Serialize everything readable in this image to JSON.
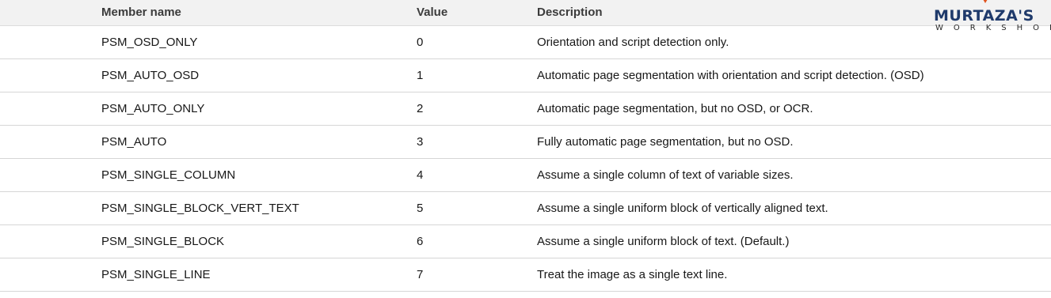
{
  "table": {
    "headers": {
      "member_name": "Member name",
      "value": "Value",
      "description": "Description"
    },
    "rows": [
      {
        "name": "PSM_OSD_ONLY",
        "value": "0",
        "description": "Orientation and script detection only."
      },
      {
        "name": "PSM_AUTO_OSD",
        "value": "1",
        "description": "Automatic page segmentation with orientation and script detection. (OSD)"
      },
      {
        "name": "PSM_AUTO_ONLY",
        "value": "2",
        "description": "Automatic page segmentation, but no OSD, or OCR."
      },
      {
        "name": "PSM_AUTO",
        "value": "3",
        "description": "Fully automatic page segmentation, but no OSD."
      },
      {
        "name": "PSM_SINGLE_COLUMN",
        "value": "4",
        "description": "Assume a single column of text of variable sizes."
      },
      {
        "name": "PSM_SINGLE_BLOCK_VERT_TEXT",
        "value": "5",
        "description": "Assume a single uniform block of vertically aligned text."
      },
      {
        "name": "PSM_SINGLE_BLOCK",
        "value": "6",
        "description": "Assume a single uniform block of text. (Default.)"
      },
      {
        "name": "PSM_SINGLE_LINE",
        "value": "7",
        "description": "Treat the image as a single text line."
      }
    ]
  },
  "watermark": {
    "title": "MURTAZA'S",
    "subtitle": "WORKSHOP",
    "brand_color": "#1f3a6b",
    "accent_color": "#e0531f"
  },
  "colors": {
    "header_background": "#f2f2f2",
    "row_divider": "#d6d6d6",
    "text": "#171717"
  }
}
